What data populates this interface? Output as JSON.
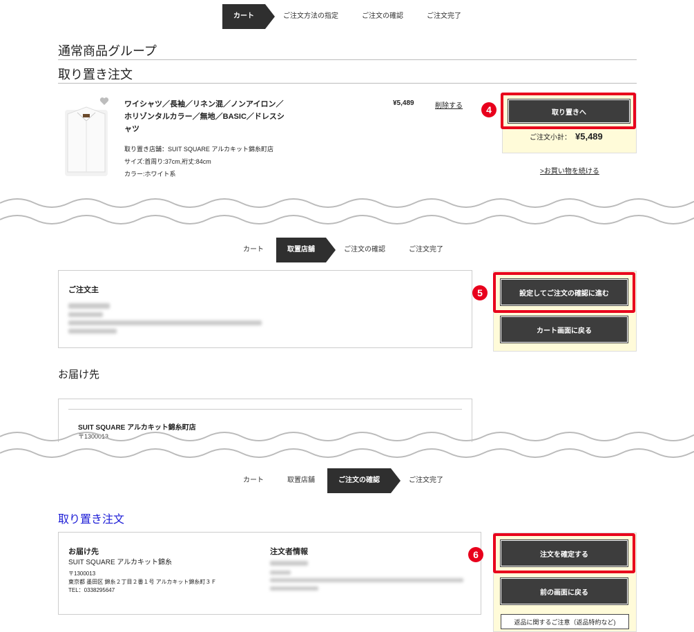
{
  "screen1": {
    "steps": [
      "カート",
      "ご注文方法の指定",
      "ご注文の確認",
      "ご注文完了"
    ],
    "group_title": "通常商品グループ",
    "section_title": "取り置き注文",
    "product": {
      "name": "ワイシャツ／長袖／リネン混／ノンアイロン／ホリゾンタルカラー／無地／BASIC／ドレスシャツ",
      "store": "取り置き店舗：SUIT SQUARE アルカキット錦糸町店",
      "size": "サイズ:首周り:37cm,裄丈:84cm",
      "color": "カラー:ホワイト系",
      "price": "¥5,489",
      "delete_label": "削除する"
    },
    "badge": "4",
    "reserve_button": "取り置きへ",
    "subtotal_label": "ご注文小計：",
    "subtotal_value": "¥5,489",
    "continue_link": ">お買い物を続ける"
  },
  "screen2": {
    "steps": [
      "カート",
      "取置店舗",
      "ご注文の確認",
      "ご注文完了"
    ],
    "orderer_title": "ご注文主",
    "badge": "5",
    "confirm_button": "設定してご注文の確認に進む",
    "back_button": "カート画面に戻る",
    "delivery_title": "お届け先",
    "store_name": "SUIT SQUARE アルカキット錦糸町店",
    "postal_partial": "〒1300013"
  },
  "screen3": {
    "steps": [
      "カート",
      "取置店舗",
      "ご注文の確認",
      "ご注文完了"
    ],
    "section_title": "取り置き注文",
    "delivery_title": "お届け先",
    "store_name": "SUIT SQUARE アルカキット錦糸",
    "postal": "〒1300013",
    "address": "東京都 墨田区 錦糸２丁目２番１号 アルカキット錦糸町３Ｆ",
    "tel": "TEL：0338295647",
    "orderer_title": "注文者情報",
    "badge": "6",
    "place_order_button": "注文を確定する",
    "prev_button": "前の画面に戻る",
    "returns_button": "返品に関するご注意（返品特約など)"
  }
}
